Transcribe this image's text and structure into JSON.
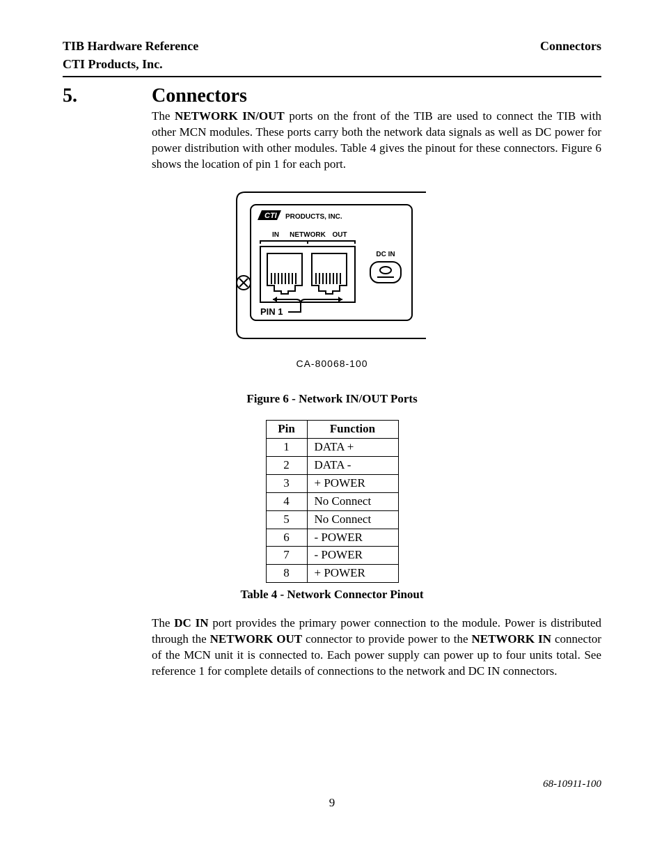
{
  "header": {
    "left1": "TIB Hardware Reference",
    "left2": "CTI Products, Inc.",
    "right": "Connectors"
  },
  "section": {
    "number": "5.",
    "title": "Connectors"
  },
  "para1": {
    "pre": "The ",
    "b1": "NETWORK IN/OUT",
    "post": " ports on the front of the TIB are used to connect the TIB with other MCN modules.  These ports carry both the network data signals as well as DC power for power distribution with other modules.  Table 4 gives the pinout for these connectors.  Figure 6 shows the location of pin 1 for each port."
  },
  "diagram": {
    "products_label": "PRODUCTS, INC.",
    "in_label": "IN",
    "network_label": "NETWORK",
    "out_label": "OUT",
    "dcin_label": "DC IN",
    "pin1_label": "PIN 1",
    "ref": "CA-80068-100"
  },
  "figure_caption": "Figure 6 - Network IN/OUT Ports",
  "table": {
    "headers": {
      "pin": "Pin",
      "fn": "Function"
    },
    "rows": [
      {
        "pin": "1",
        "fn": "DATA +"
      },
      {
        "pin": "2",
        "fn": "DATA -"
      },
      {
        "pin": "3",
        "fn": "+ POWER"
      },
      {
        "pin": "4",
        "fn": "No Connect"
      },
      {
        "pin": "5",
        "fn": "No Connect"
      },
      {
        "pin": "6",
        "fn": "- POWER"
      },
      {
        "pin": "7",
        "fn": "- POWER"
      },
      {
        "pin": "8",
        "fn": "+ POWER"
      }
    ]
  },
  "table_caption": "Table 4 - Network Connector Pinout",
  "para2": {
    "t0": "The ",
    "b0": "DC IN",
    "t1": " port provides the primary power connection to the module.  Power is distributed through the ",
    "b1": "NETWORK OUT",
    "t2": " connector to provide power to the ",
    "b2": "NETWORK IN",
    "t3": " connector of the MCN unit it is connected to.  Each power supply can power up to four units total.  See reference 1 for complete details of connections to the network and DC IN connectors."
  },
  "footer": {
    "doc_id": "68-10911-100",
    "page": "9"
  }
}
